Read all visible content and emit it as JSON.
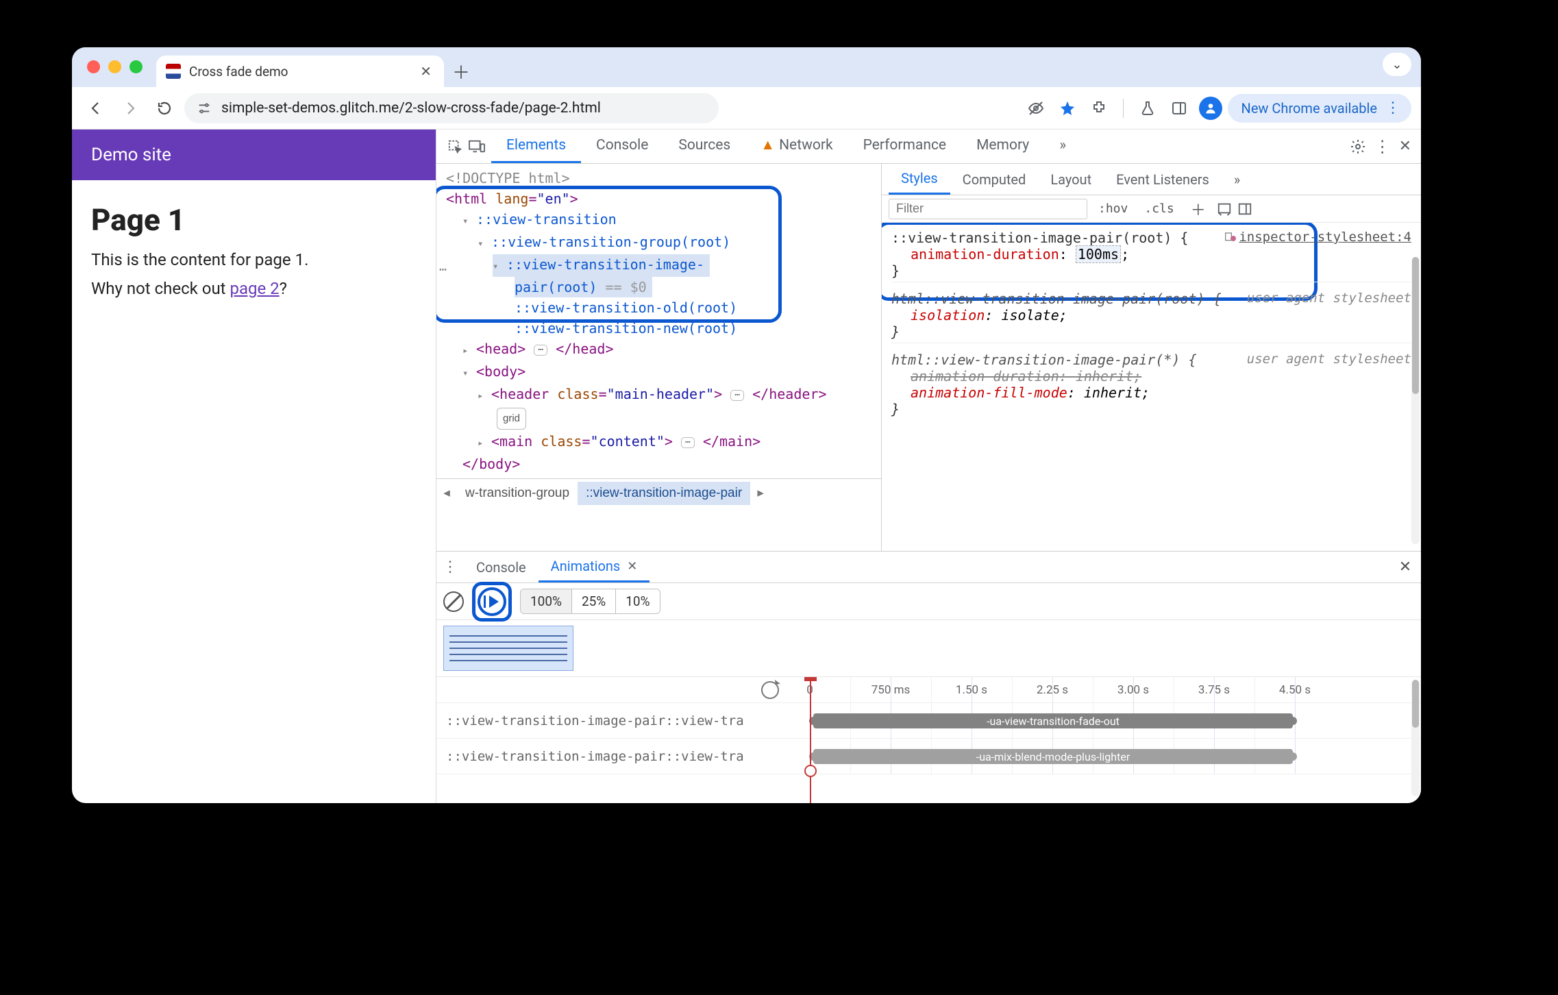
{
  "browser": {
    "tab_title": "Cross fade demo",
    "url": "simple-set-demos.glitch.me/2-slow-cross-fade/page-2.html",
    "update_pill": "New Chrome available"
  },
  "page": {
    "site_title": "Demo site",
    "heading": "Page 1",
    "para1": "This is the content for page 1.",
    "para2_pre": "Why not check out ",
    "link_text": "page 2",
    "para2_post": "?"
  },
  "devtools": {
    "tabs": {
      "elements": "Elements",
      "console": "Console",
      "sources": "Sources",
      "network": "Network",
      "performance": "Performance",
      "memory": "Memory"
    },
    "dom": {
      "doctype": "<!DOCTYPE html>",
      "html_open_pre": "<html ",
      "html_attr": "lang",
      "html_val": "\"en\"",
      "vt": "::view-transition",
      "vt_group": "::view-transition-group(root)",
      "vt_pair_l1": "::view-transition-image-",
      "vt_pair_l2": "pair(root)",
      "eqzero": " == $0",
      "vt_old": "::view-transition-old(root)",
      "vt_new": "::view-transition-new(root)",
      "head_open": "<head>",
      "head_close": "</head>",
      "body_open": "<body>",
      "header_open_pre": "<header ",
      "header_attr": "class",
      "header_val": "\"main-header\"",
      "header_close": "</header>",
      "grid_badge": "grid",
      "main_open_pre": "<main ",
      "main_attr": "class",
      "main_val": "\"content\"",
      "main_close": "</main>",
      "body_close": "</body>"
    },
    "crumbs": {
      "c1": "w-transition-group",
      "c2": "::view-transition-image-pair"
    },
    "styles": {
      "tabs": {
        "styles": "Styles",
        "computed": "Computed",
        "layout": "Layout",
        "event": "Event Listeners"
      },
      "filter_placeholder": "Filter",
      "hov": ":hov",
      "cls": ".cls",
      "rule1_src": "inspector-stylesheet:4",
      "rule1_sel": "::view-transition-image-pair(root) {",
      "rule1_prop": "animation-duration",
      "rule1_val": "100ms",
      "rule2_src": "user agent stylesheet",
      "rule2_sel": "html::view-transition-image-pair(root) {",
      "rule2_prop": "isolation",
      "rule2_val": "isolate",
      "rule3_src": "user agent stylesheet",
      "rule3_sel": "html::view-transition-image-pair(*) {",
      "rule3_p1": "animation-duration",
      "rule3_v1": "inherit",
      "rule3_p2": "animation-fill-mode",
      "rule3_v2": "inherit",
      "brace_close": "}"
    }
  },
  "drawer": {
    "console": "Console",
    "animations": "Animations",
    "speeds": {
      "s100": "100%",
      "s25": "25%",
      "s10": "10%"
    },
    "ticks": [
      "0",
      "750 ms",
      "1.50 s",
      "2.25 s",
      "3.00 s",
      "3.75 s",
      "4.50 s"
    ],
    "row1_label": "::view-transition-image-pair::view-tra",
    "row1_bar": "-ua-view-transition-fade-out",
    "row2_label": "::view-transition-image-pair::view-tra",
    "row2_bar": "-ua-mix-blend-mode-plus-lighter"
  }
}
